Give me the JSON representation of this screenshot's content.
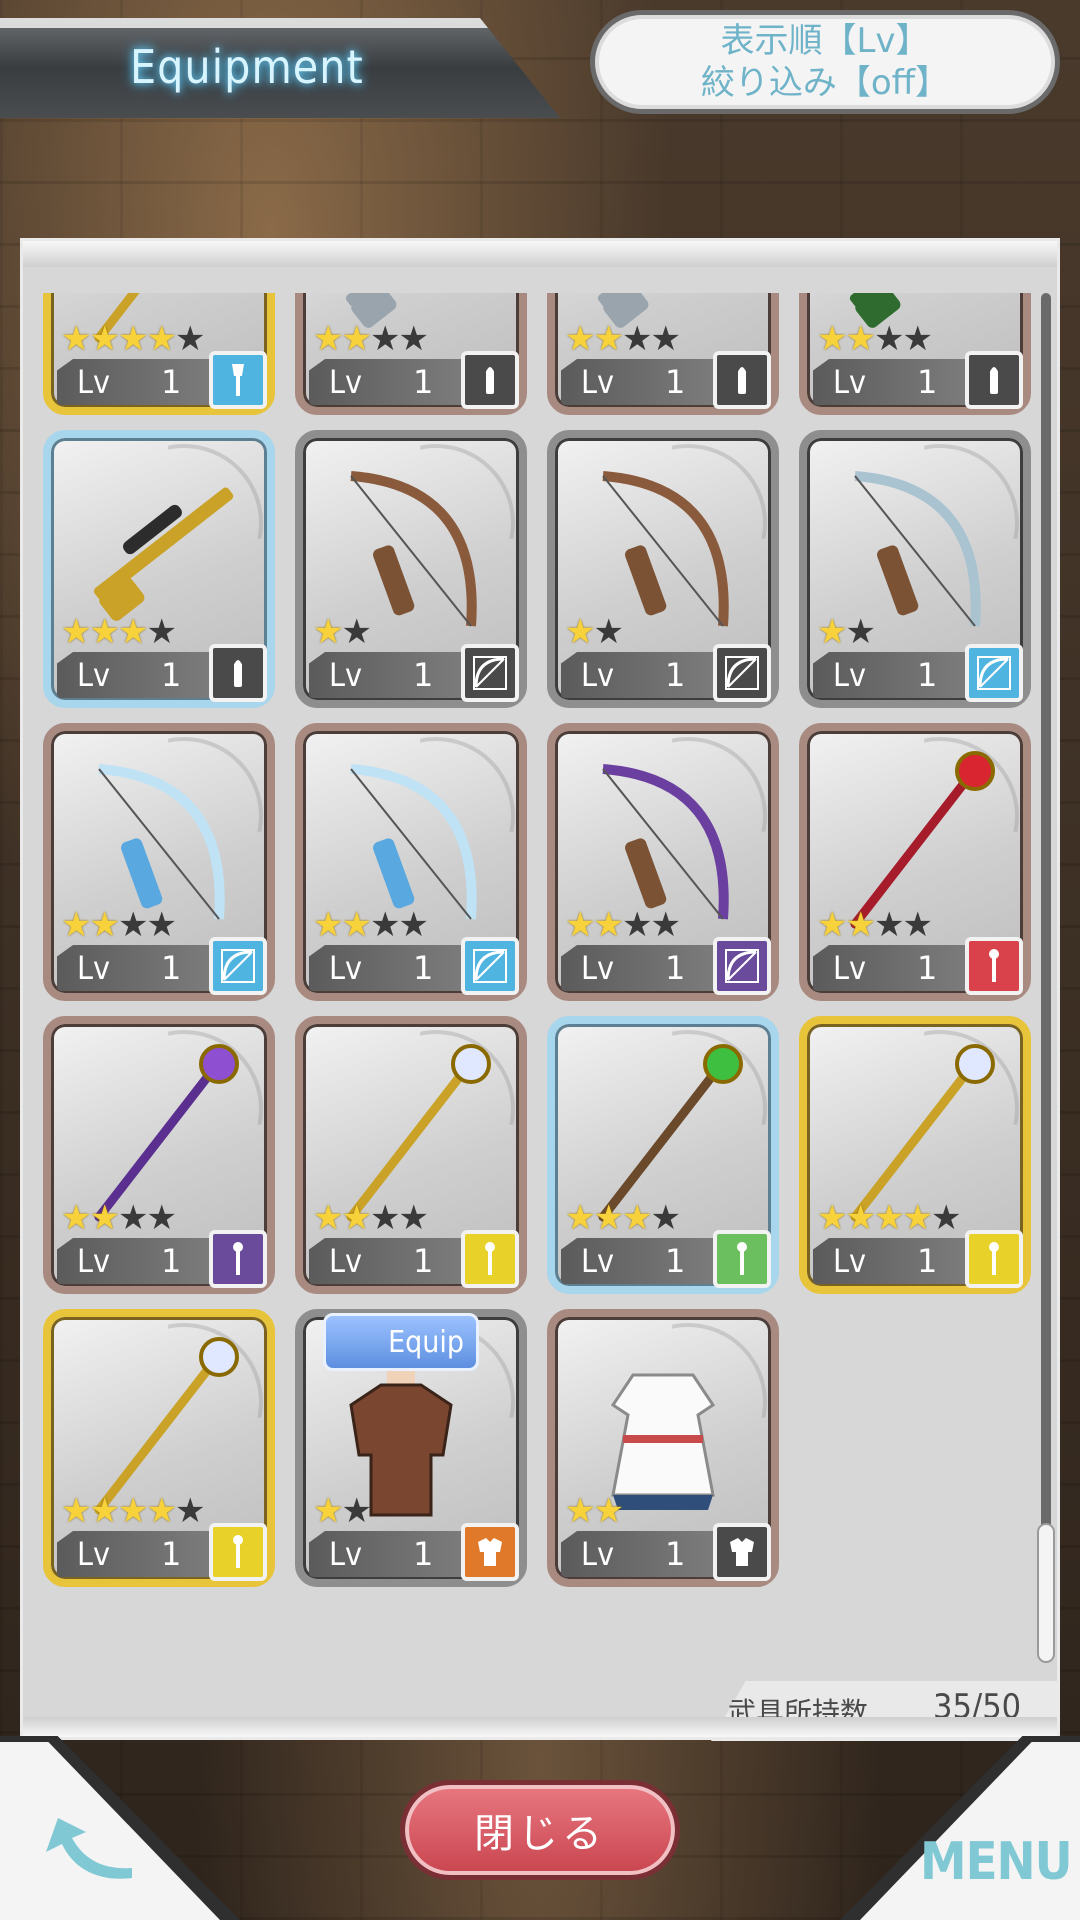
{
  "header": {
    "title": "Equipment",
    "sort_line1": "表示順【Lv】",
    "sort_line2": "絞り込み【off】"
  },
  "inventory": {
    "count_label": "武具所持数",
    "count_value": "35/50"
  },
  "footer": {
    "close_label": "閉じる",
    "menu_label": "MENU"
  },
  "lv_text": "Lv",
  "colors": {
    "type_blue": "#4fb4e0",
    "type_gray": "#4a4a4a",
    "type_purple": "#6a4a9a",
    "type_red": "#d9424a",
    "type_yellow": "#e8d22a",
    "type_green": "#6cbf5e",
    "type_orange": "#e07a2a",
    "star_on": "#f7d23a"
  },
  "items": [
    {
      "item": "staff-blue-ornate",
      "stars": 4,
      "max_stars": 5,
      "level": "1",
      "type_icon": "mace-icon",
      "type_color": "#4fb4e0",
      "frame": "gold",
      "equipped": false
    },
    {
      "item": "rifle-silver",
      "stars": 2,
      "max_stars": 4,
      "level": "1",
      "type_icon": "bullet-icon",
      "type_color": "#4a4a4a",
      "frame": "brown",
      "equipped": false
    },
    {
      "item": "rifle-silver",
      "stars": 2,
      "max_stars": 4,
      "level": "1",
      "type_icon": "bullet-icon",
      "type_color": "#4a4a4a",
      "frame": "brown",
      "equipped": false
    },
    {
      "item": "rifle-green",
      "stars": 2,
      "max_stars": 4,
      "level": "1",
      "type_icon": "bullet-icon",
      "type_color": "#4a4a4a",
      "frame": "brown",
      "equipped": false
    },
    {
      "item": "rifle-gold",
      "stars": 3,
      "max_stars": 4,
      "level": "1",
      "type_icon": "bullet-icon",
      "type_color": "#4a4a4a",
      "frame": "blue",
      "equipped": false
    },
    {
      "item": "bow-wood",
      "stars": 1,
      "max_stars": 2,
      "level": "1",
      "type_icon": "bow-icon",
      "type_color": "#4a4a4a",
      "frame": "gray",
      "equipped": false
    },
    {
      "item": "bow-wood",
      "stars": 1,
      "max_stars": 2,
      "level": "1",
      "type_icon": "bow-icon",
      "type_color": "#4a4a4a",
      "frame": "gray",
      "equipped": false
    },
    {
      "item": "bow-steel",
      "stars": 1,
      "max_stars": 2,
      "level": "1",
      "type_icon": "bow-icon",
      "type_color": "#4fb4e0",
      "frame": "gray",
      "equipped": false
    },
    {
      "item": "bow-ice",
      "stars": 2,
      "max_stars": 4,
      "level": "1",
      "type_icon": "bow-icon",
      "type_color": "#4fb4e0",
      "frame": "brown",
      "equipped": false
    },
    {
      "item": "bow-ice",
      "stars": 2,
      "max_stars": 4,
      "level": "1",
      "type_icon": "bow-icon",
      "type_color": "#4fb4e0",
      "frame": "brown",
      "equipped": false
    },
    {
      "item": "bow-purple",
      "stars": 2,
      "max_stars": 4,
      "level": "1",
      "type_icon": "bow-icon",
      "type_color": "#6a4a9a",
      "frame": "brown",
      "equipped": false
    },
    {
      "item": "spear-red",
      "stars": 2,
      "max_stars": 4,
      "level": "1",
      "type_icon": "staff-icon",
      "type_color": "#d9424a",
      "frame": "brown",
      "equipped": false
    },
    {
      "item": "trident-purple",
      "stars": 2,
      "max_stars": 4,
      "level": "1",
      "type_icon": "staff-icon",
      "type_color": "#6a4a9a",
      "frame": "brown",
      "equipped": false
    },
    {
      "item": "staff-crystal",
      "stars": 2,
      "max_stars": 4,
      "level": "1",
      "type_icon": "staff-icon",
      "type_color": "#e8d22a",
      "frame": "brown",
      "equipped": false
    },
    {
      "item": "staff-green-orb",
      "stars": 3,
      "max_stars": 4,
      "level": "1",
      "type_icon": "staff-icon",
      "type_color": "#6cbf5e",
      "frame": "blue",
      "equipped": false
    },
    {
      "item": "staff-gold-feather",
      "stars": 4,
      "max_stars": 5,
      "level": "1",
      "type_icon": "staff-icon",
      "type_color": "#e8d22a",
      "frame": "gold",
      "equipped": false
    },
    {
      "item": "staff-gold-feather",
      "stars": 4,
      "max_stars": 5,
      "level": "1",
      "type_icon": "staff-icon",
      "type_color": "#e8d22a",
      "frame": "gold",
      "equipped": false
    },
    {
      "item": "armor-leather",
      "stars": 1,
      "max_stars": 2,
      "level": "1",
      "type_icon": "armor-icon",
      "type_color": "#e07a2a",
      "frame": "gray",
      "equipped": true,
      "equip_label": "Equip"
    },
    {
      "item": "dress-white",
      "stars": 2,
      "max_stars": 2,
      "level": "1",
      "type_icon": "armor-icon",
      "type_color": "#4a4a4a",
      "frame": "brown",
      "equipped": false
    }
  ]
}
